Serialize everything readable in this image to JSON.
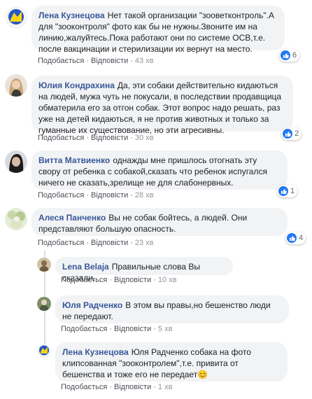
{
  "actions": {
    "like": "Подобається",
    "reply": "Відповісти"
  },
  "comments": [
    {
      "author": "Лена Кузнецова",
      "text": "Нет такой организации \"зооветконтроль\".А для \"зооконтроля\" фото как бы не нужны.Звоните им на линию,жалуйтесь.Пока работают они по системе ОСВ,т.е. после вакцинации и стерилизации их вернут на место.",
      "time": "43 хв",
      "reactions": "6"
    },
    {
      "author": "Юлия Кондрахина",
      "text": "Да, эти собаки действительно кидаються на людей, мужа чуть не покусали, в последствии продавщица обматерила его за отгон собак. Этот вопрос надо решать, раз уже на детей кидаються, я не против животных и только за гуманные их существование, но эти агресивны.",
      "time": "30 хв",
      "reactions": "2"
    },
    {
      "author": "Витта Матвиенко",
      "text": "однажды мне пришлось отогнать эту свору от ребенка с собакой,сказать что ребенок испугался ничего не сказать,зрелище не для слабонервных.",
      "time": "28 хв",
      "reactions": "1"
    },
    {
      "author": "Алеся Панченко",
      "text": "Вы не собак бойтесь, а людей. Они представляют большую опасность.",
      "time": "23 хв",
      "reactions": "4"
    }
  ],
  "replies": [
    {
      "author": "Lena Belaja",
      "text": "Правильные слова Вы сказали.",
      "time": "10 хв"
    },
    {
      "author": "Юля Радченко",
      "text": "В этом вы правы,но бешенство люди не передают.",
      "time": "5 хв"
    },
    {
      "author": "Лена Кузнецова",
      "text": "Юля Радченко собака на фото клипсованная \"зооконтролем\",т.е. привита от бешенства и тоже его не передает",
      "emoji": "😊",
      "time": "1 хв"
    }
  ],
  "colors": {
    "author": "#385898",
    "bubble": "#f2f3f5",
    "like_blue": "#2078f4",
    "meta": "#606770"
  }
}
